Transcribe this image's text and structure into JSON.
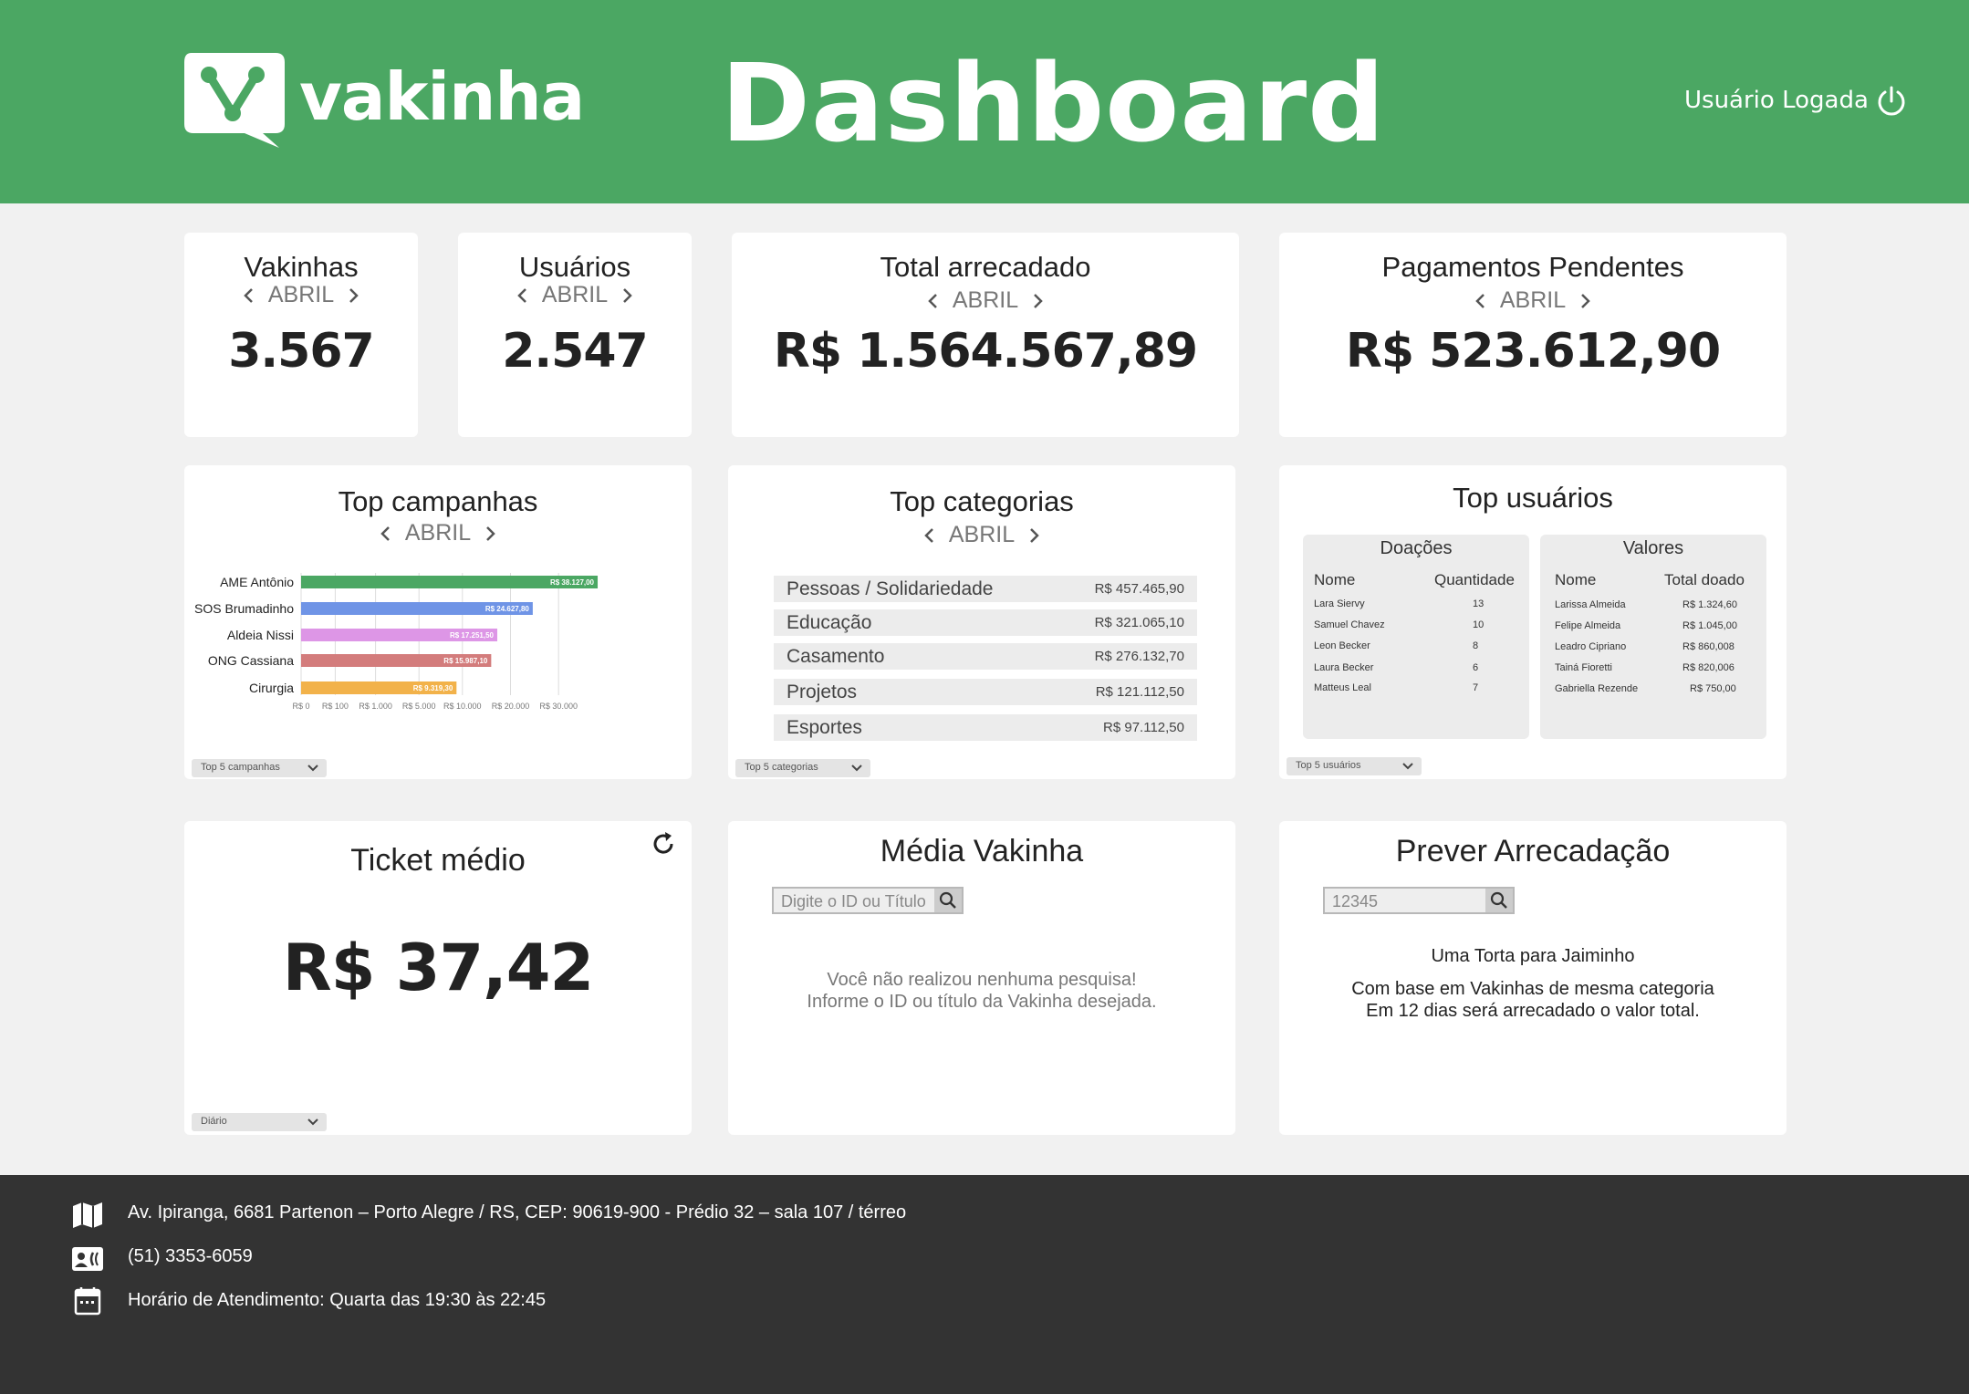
{
  "header": {
    "logo_text": "vakinha",
    "title": "Dashboard",
    "user_label": "Usuário Logada"
  },
  "stats": {
    "vakinhas": {
      "title": "Vakinhas",
      "month": "ABRIL",
      "value": "3.567"
    },
    "usuarios": {
      "title": "Usuários",
      "month": "ABRIL",
      "value": "2.547"
    },
    "total": {
      "title": "Total arrecadado",
      "month": "ABRIL",
      "value": "R$ 1.564.567,89"
    },
    "pendentes": {
      "title": "Pagamentos Pendentes",
      "month": "ABRIL",
      "value": "R$ 523.612,90"
    }
  },
  "top_campanhas": {
    "title": "Top campanhas",
    "month": "ABRIL",
    "dropdown": "Top 5 campanhas"
  },
  "chart_data": {
    "type": "bar",
    "orientation": "horizontal",
    "categories": [
      "AME Antônio",
      "SOS Brumadinho",
      "Aldeia Nissi",
      "ONG Cassiana",
      "Cirurgia"
    ],
    "values": [
      38127,
      24627.8,
      17251.5,
      15987.1,
      9319.3
    ],
    "data_labels": [
      "R$ 38.127,00",
      "R$ 24.627,80",
      "R$ 17.251,50",
      "R$ 15.987,10",
      "R$ 9.319,30"
    ],
    "colors": [
      "#4ba763",
      "#6f94e6",
      "#dd96e6",
      "#d37c7c",
      "#f2b24a"
    ],
    "x_ticks": [
      "R$ 0",
      "R$ 100",
      "R$ 1.000",
      "R$ 5.000",
      "R$ 10.000",
      "R$ 20.000",
      "R$ 30.000"
    ],
    "x_tick_values": [
      0,
      100,
      1000,
      5000,
      10000,
      20000,
      30000
    ],
    "grid": true
  },
  "top_categorias": {
    "title": "Top categorias",
    "month": "ABRIL",
    "dropdown": "Top 5 categorias",
    "rows": [
      {
        "name": "Pessoas / Solidariedade",
        "value": "R$ 457.465,90"
      },
      {
        "name": "Educação",
        "value": "R$ 321.065,10"
      },
      {
        "name": "Casamento",
        "value": "R$ 276.132,70"
      },
      {
        "name": "Projetos",
        "value": "R$ 121.112,50"
      },
      {
        "name": "Esportes",
        "value": "R$ 97.112,50"
      }
    ]
  },
  "top_usuarios": {
    "title": "Top usuários",
    "dropdown": "Top 5 usuários",
    "doacoes": {
      "title": "Doações",
      "col_name": "Nome",
      "col_value": "Quantidade",
      "rows": [
        {
          "name": "Lara Siervy",
          "value": "13"
        },
        {
          "name": "Samuel Chavez",
          "value": "10"
        },
        {
          "name": "Leon Becker",
          "value": "8"
        },
        {
          "name": "Laura Becker",
          "value": "6"
        },
        {
          "name": "Matteus Leal",
          "value": "7"
        }
      ]
    },
    "valores": {
      "title": "Valores",
      "col_name": "Nome",
      "col_value": "Total doado",
      "rows": [
        {
          "name": "Larissa Almeida",
          "value": "R$ 1.324,60"
        },
        {
          "name": "Felipe Almeida",
          "value": "R$ 1.045,00"
        },
        {
          "name": "Leadro Cipriano",
          "value": "R$ 860,008"
        },
        {
          "name": "Tainá Fioretti",
          "value": "R$ 820,006"
        },
        {
          "name": "Gabriella Rezende",
          "value": "R$ 750,00"
        }
      ]
    }
  },
  "ticket": {
    "title": "Ticket médio",
    "value": "R$ 37,42",
    "dropdown": "Diário"
  },
  "media": {
    "title": "Média Vakinha",
    "search_placeholder": "Digite o ID ou Título",
    "msg1": "Você não realizou nenhuma pesquisa!",
    "msg2": "Informe o ID ou título da Vakinha desejada."
  },
  "prever": {
    "title": "Prever Arrecadação",
    "search_value": "12345",
    "result_title": "Uma Torta para Jaiminho",
    "line1": "Com base em Vakinhas de mesma categoria",
    "line2": "Em 12 dias será arrecadado o valor total."
  },
  "footer": {
    "address": "Av. Ipiranga, 6681 Partenon – Porto Alegre / RS,  CEP: 90619-900 - Prédio 32 – sala 107 / térreo",
    "phone": "(51) 3353-6059",
    "hours": "Horário de Atendimento: Quarta das 19:30 às 22:45"
  },
  "colors": {
    "brand": "#4ba763",
    "footer": "#333333",
    "background": "#f1f1f1"
  }
}
